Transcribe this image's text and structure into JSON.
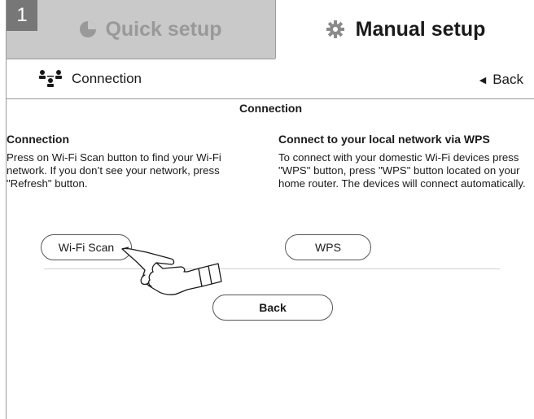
{
  "step_number": "1",
  "tabs": {
    "quick_label": "Quick setup",
    "manual_label": "Manual setup"
  },
  "header": {
    "title": "Connection",
    "back_label": "Back"
  },
  "section_title": "Connection",
  "left": {
    "heading": "Connection",
    "body": "Press on Wi-Fi Scan button to find your Wi-Fi network. If you don’t see your network, press \"Refresh\" button.",
    "button": "Wi-Fi Scan"
  },
  "right": {
    "heading": "Connect to your local network via WPS",
    "body": "To connect with your domestic Wi-Fi devices press \"WPS\" button, press \"WPS\" button located on your home router. The devices will connect automatically.",
    "button": "WPS"
  },
  "bottom_button": "Back",
  "icons": {
    "quick": "clock-pie-icon",
    "manual": "gear-icon",
    "connection": "network-users-icon",
    "back": "triangle-left-icon",
    "pointer": "pointing-hand-icon"
  }
}
